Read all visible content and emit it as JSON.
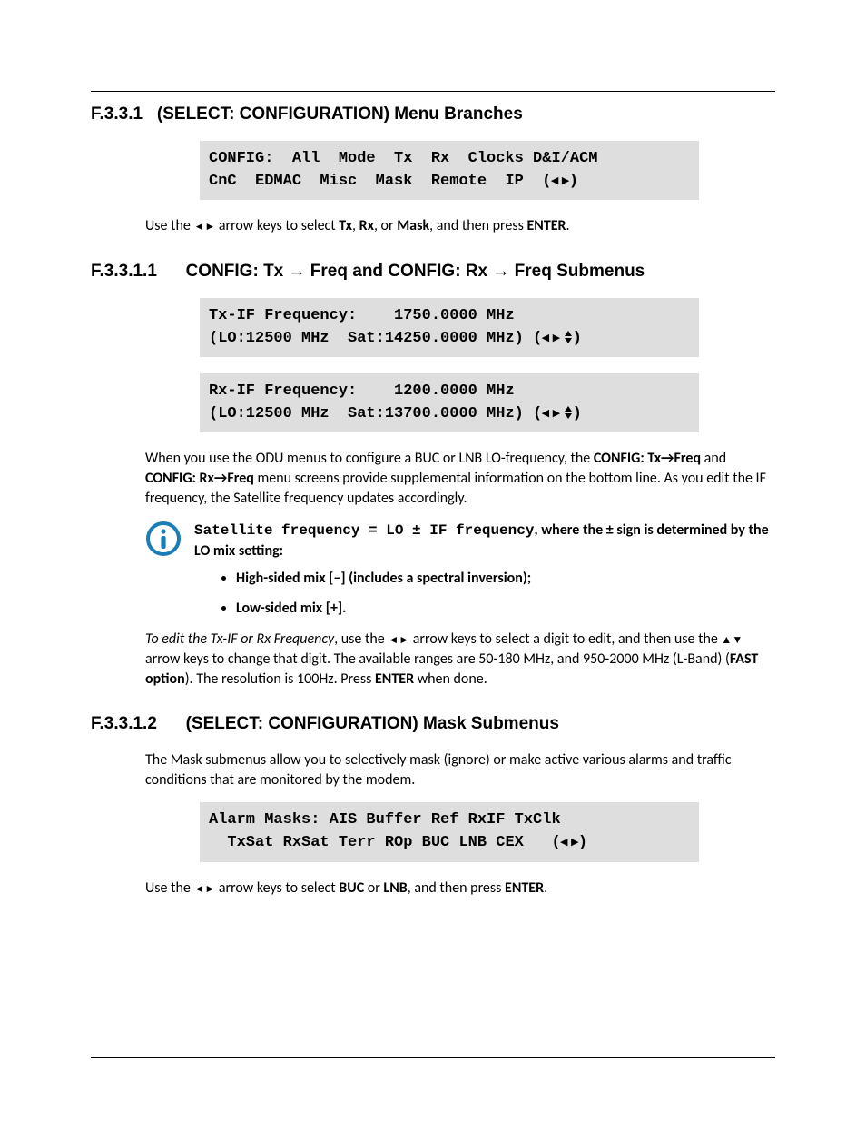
{
  "s1": {
    "num": "F.3.3.1",
    "title": "(SELECT: CONFIGURATION) Menu Branches",
    "code_l1": "CONFIG:  All  Mode  Tx  Rx  Clocks D&I/ACM",
    "code_l2": "CnC  EDMAC  Misc  Mask  Remote  IP  (",
    "code_l2_tail": ")",
    "p_use_a": "Use the ",
    "p_use_b": " arrow keys to select ",
    "p_tx": "Tx",
    "p_sep1": ", ",
    "p_rx": "Rx",
    "p_sep2": ", or ",
    "p_mask": "Mask",
    "p_sep3": ", and then press ",
    "p_enter": "ENTER",
    "p_tail": "."
  },
  "s11": {
    "num": "F.3.3.1.1",
    "title_a": "CONFIG: Tx ",
    "title_b": " Freq and CONFIG: Rx  ",
    "title_c": " Freq Submenus",
    "tx_l1": "Tx-IF Frequency:    1750.0000 MHz",
    "tx_l2a": "(LO:12500 MHz  Sat:14250.0000 MHz) (",
    "tx_l2b": ")",
    "rx_l1": "Rx-IF Frequency:    1200.0000 MHz",
    "rx_l2a": "(LO:12500 MHz  Sat:13700.0000 MHz) (",
    "rx_l2b": ")",
    "para1_a": "When you use the ODU menus to configure a BUC or LNB LO-frequency, the ",
    "para1_b": "CONFIG: Tx→Freq",
    "para1_c": " and ",
    "para1_d": "CONFIG: Rx→Freq",
    "para1_e": " menu screens provide supplemental information on the bottom line. As you edit the IF frequency, the Satellite frequency updates accordingly.",
    "note_eq": "Satellite frequency = LO ± IF frequency",
    "note_tail": ", where the ± sign is determined by the LO mix setting:",
    "bul1": "High-sided mix [–] (includes a spectral inversion);",
    "bul2": "Low-sided mix [+].",
    "para2_it": "To edit the Tx-IF or Rx Frequency",
    "para2_a": ", use the ",
    "para2_b": " arrow keys to select a digit to edit, and then use the ",
    "para2_c": " arrow keys to change that digit. The available ranges are 50-180 MHz, and 950-2000 MHz (L-Band) (",
    "para2_fast": "FAST option",
    "para2_d": "). The resolution is 100Hz. Press ",
    "para2_enter": "ENTER",
    "para2_e": " when done."
  },
  "s12": {
    "num": "F.3.3.1.2",
    "title": "(SELECT: CONFIGURATION) Mask Submenus",
    "p1": "The Mask submenus allow you to selectively mask (ignore) or make active various alarms and traffic conditions that are monitored by the modem.",
    "code_l1": "Alarm Masks: AIS Buffer Ref RxIF TxClk",
    "code_l2a": "  TxSat RxSat Terr ROp BUC LNB CEX   (",
    "code_l2b": ")",
    "p_use_a": "Use the ",
    "p_use_b": " arrow keys to select ",
    "p_buc": "BUC",
    "p_sep1": " or ",
    "p_lnb": "LNB",
    "p_sep2": ", and then press ",
    "p_enter": "ENTER",
    "p_tail": "."
  },
  "glyph": {
    "left": "◄",
    "right": "►",
    "up": "▲",
    "down": "▼",
    "arrow": "→",
    "tri_l": "◂",
    "tri_r": "▸",
    "tri_ud": "◂ ▸ ⇕"
  }
}
